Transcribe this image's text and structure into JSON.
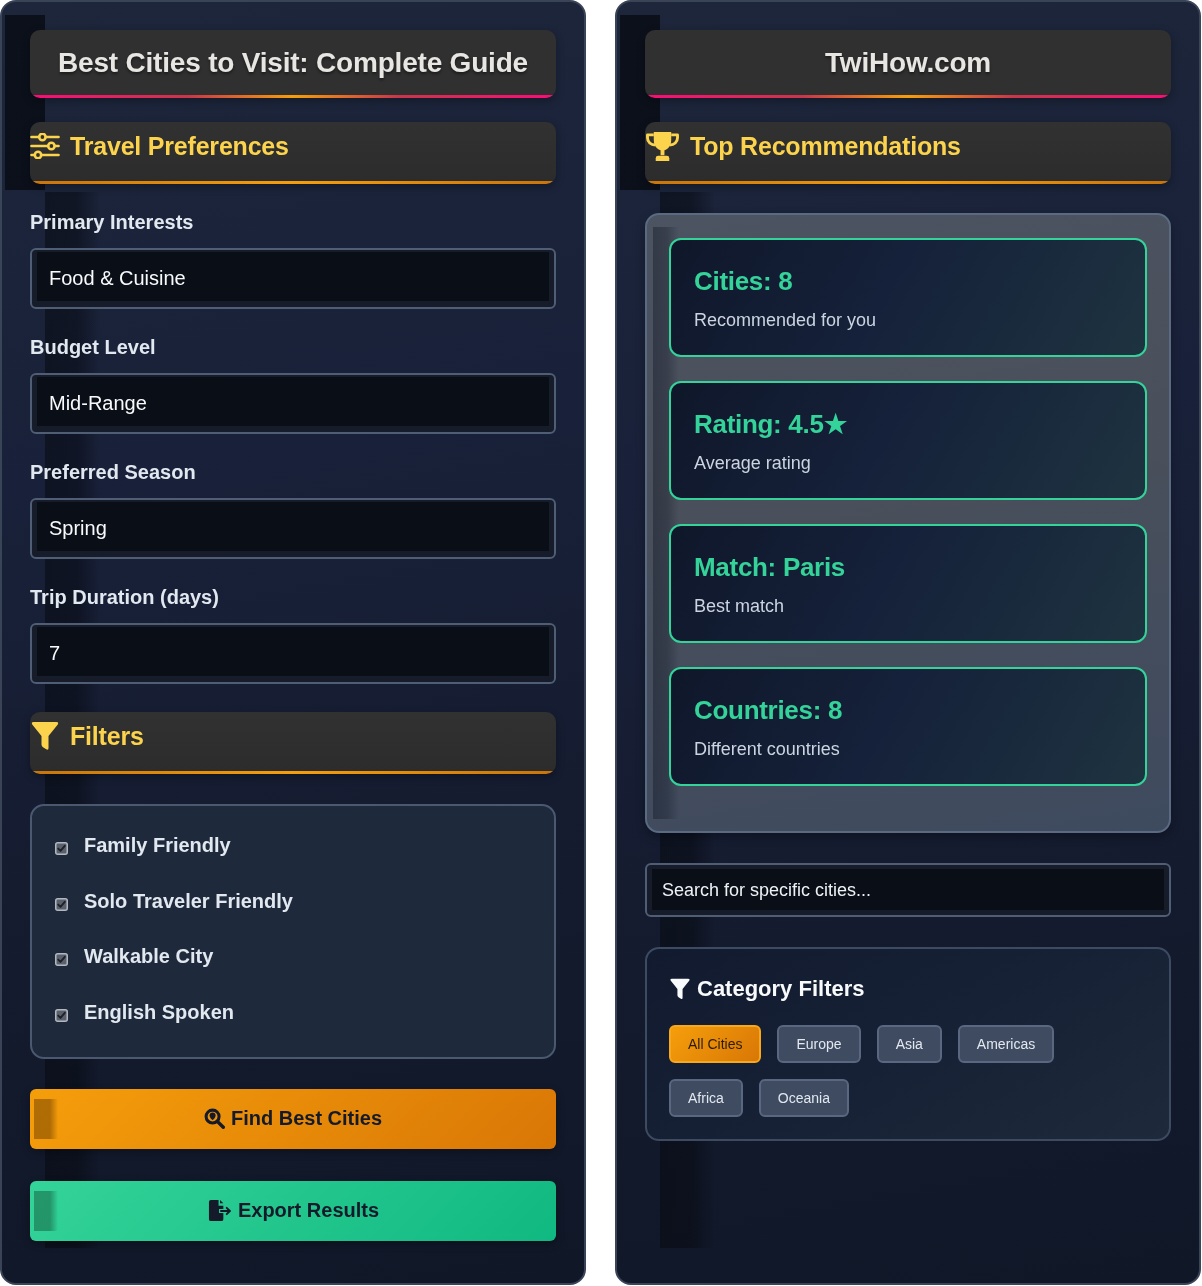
{
  "left_panel": {
    "title": "Best Cities to Visit: Complete Guide",
    "preferences": {
      "heading": "Travel Preferences",
      "fields": [
        {
          "label": "Primary Interests",
          "value": "Food & Cuisine"
        },
        {
          "label": "Budget Level",
          "value": "Mid-Range"
        },
        {
          "label": "Preferred Season",
          "value": "Spring"
        },
        {
          "label": "Trip Duration (days)",
          "value": "7"
        }
      ]
    },
    "filters": {
      "heading": "Filters",
      "options": [
        {
          "label": "Family Friendly",
          "checked": true
        },
        {
          "label": "Solo Traveler Friendly",
          "checked": true
        },
        {
          "label": "Walkable City",
          "checked": true
        },
        {
          "label": "English Spoken",
          "checked": true
        }
      ]
    },
    "buttons": [
      {
        "label": "Find Best Cities",
        "kind": "primary"
      },
      {
        "label": "Export Results",
        "kind": "success"
      }
    ]
  },
  "right_panel": {
    "title": "TwiHow.com",
    "recommendations": {
      "heading": "Top Recommendations",
      "stats": [
        {
          "title": "Cities: 8",
          "caption": "Recommended for you"
        },
        {
          "title": "Rating: 4.5★",
          "caption": "Average rating"
        },
        {
          "title": "Match: Paris",
          "caption": "Best match"
        },
        {
          "title": "Countries: 8",
          "caption": "Different countries"
        }
      ]
    },
    "search": {
      "placeholder": "Search for specific cities..."
    },
    "category_filters": {
      "heading": "Category Filters",
      "chips": [
        {
          "label": "All Cities",
          "selected": true
        },
        {
          "label": "Europe",
          "selected": false
        },
        {
          "label": "Asia",
          "selected": false
        },
        {
          "label": "Americas",
          "selected": false
        },
        {
          "label": "Africa",
          "selected": false
        },
        {
          "label": "Oceania",
          "selected": false
        }
      ]
    }
  }
}
